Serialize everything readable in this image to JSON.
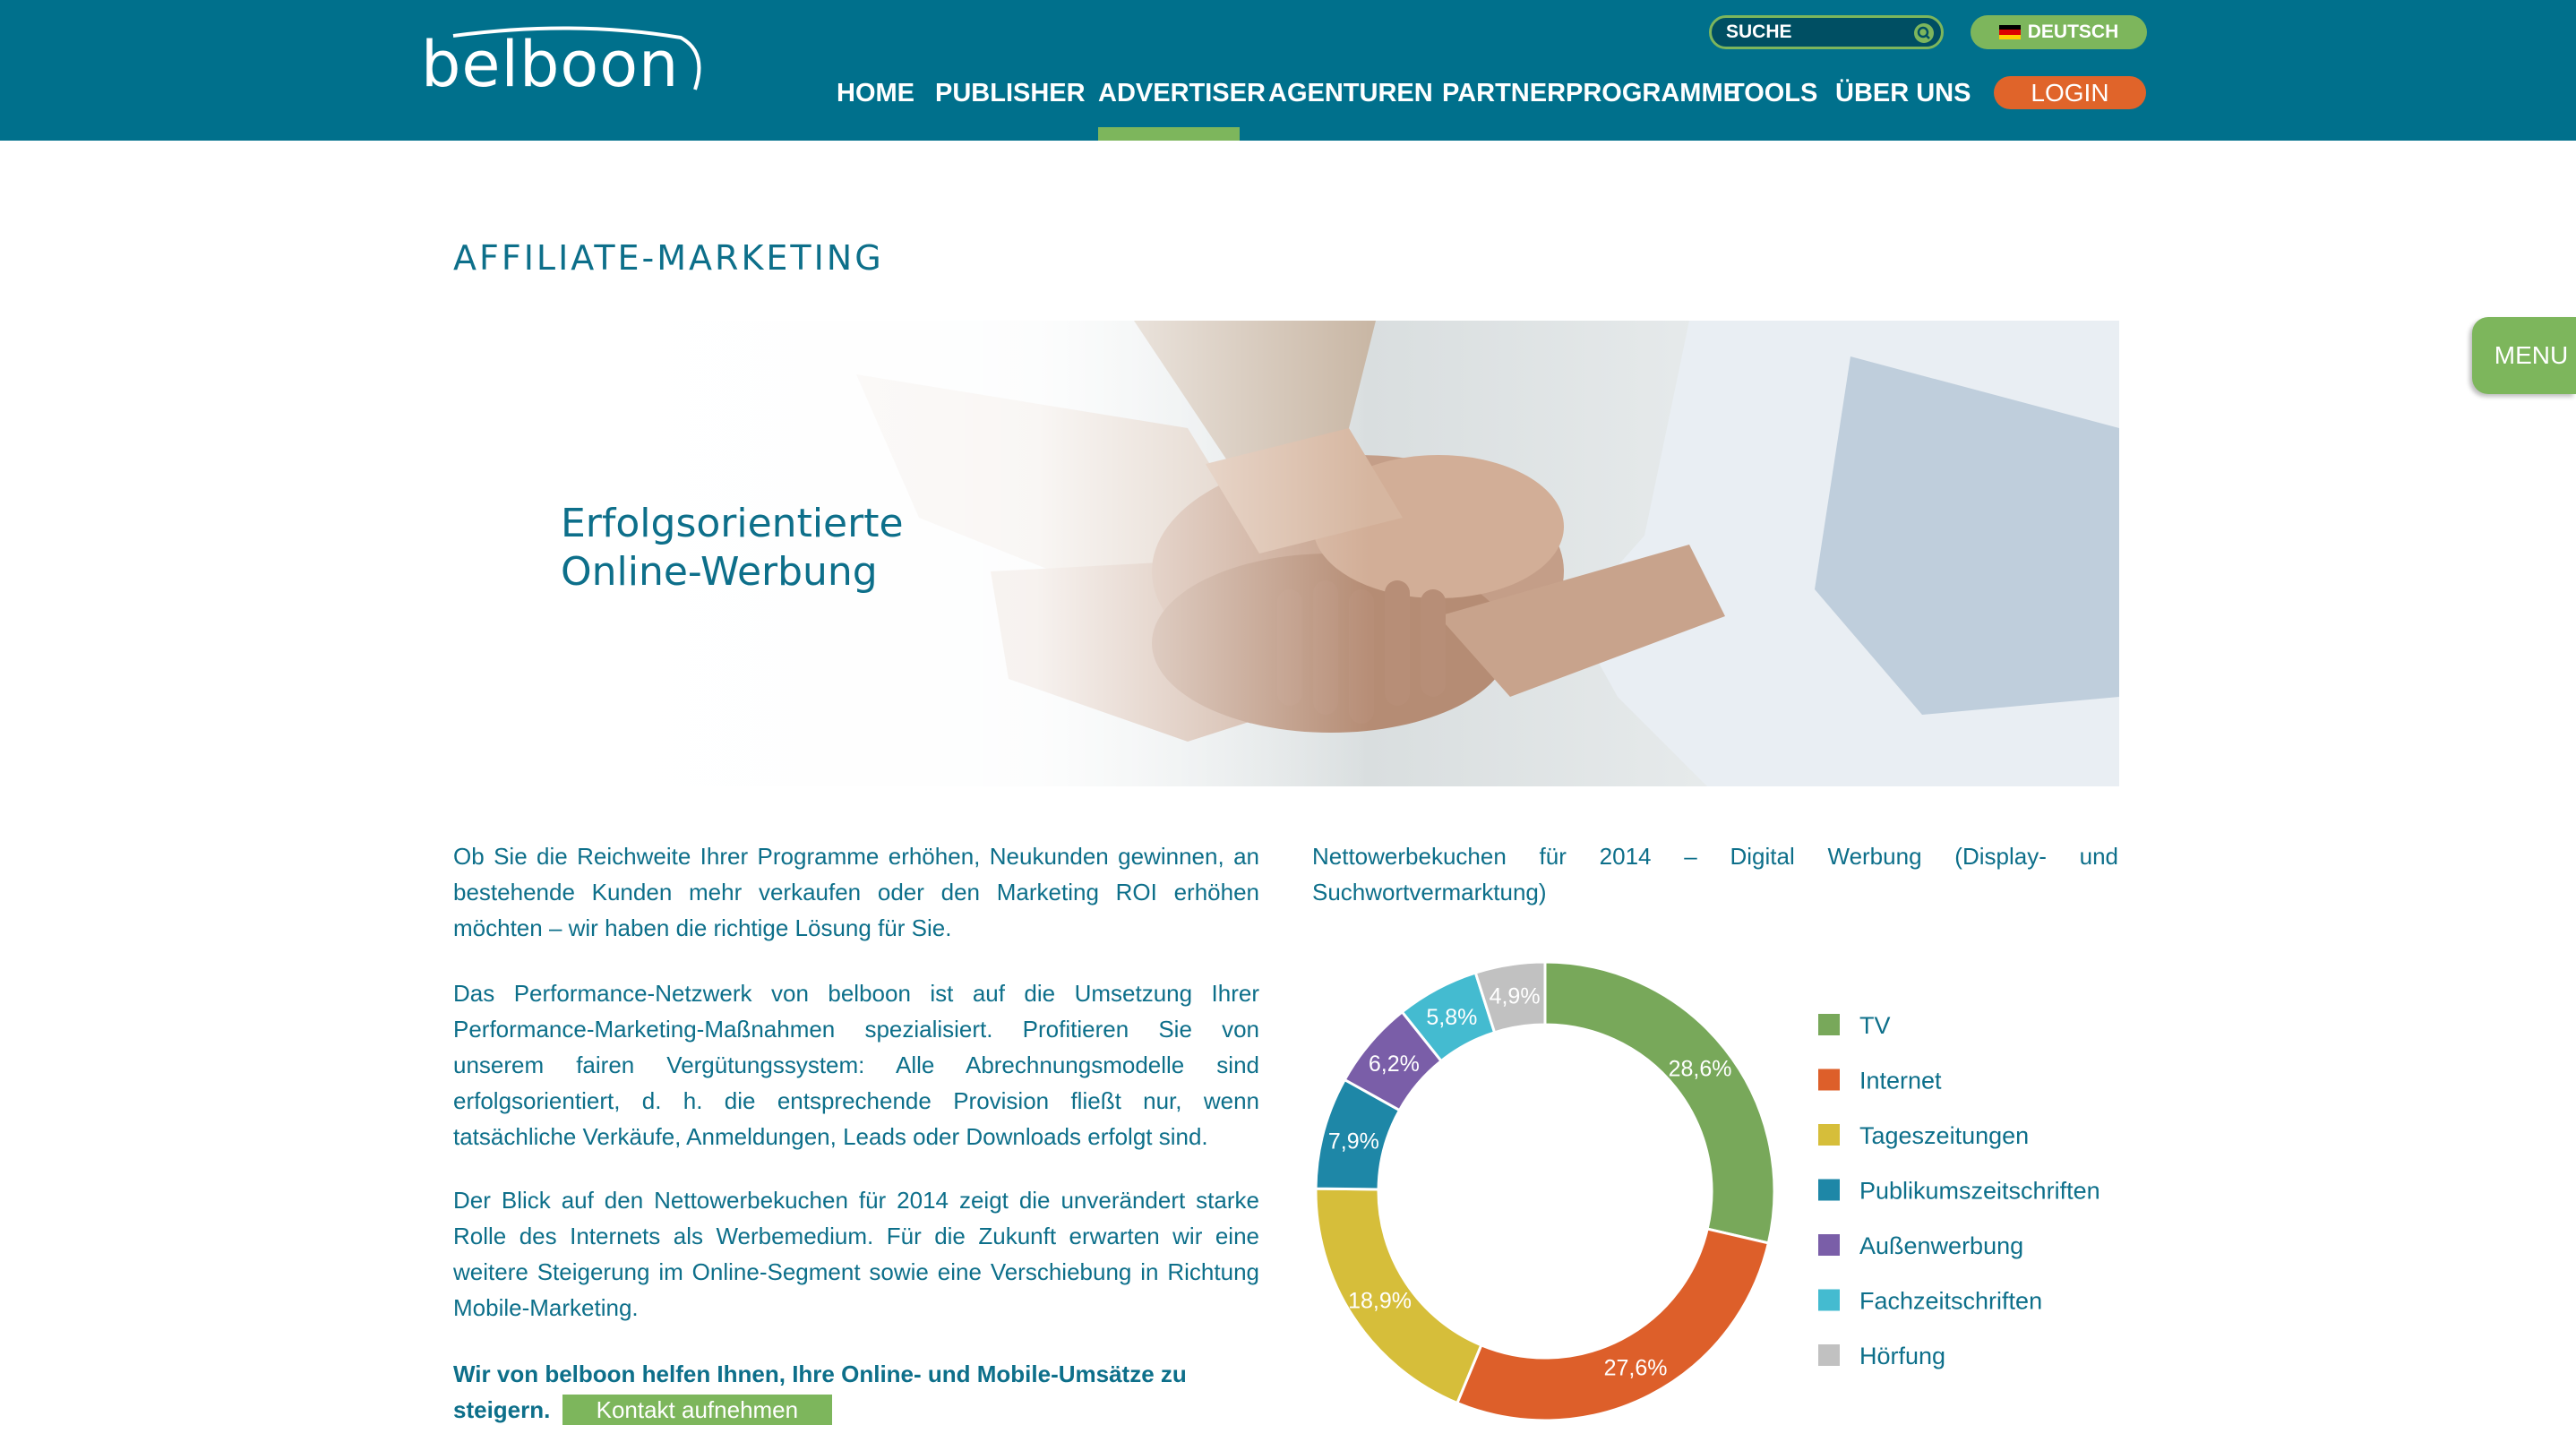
{
  "header": {
    "logo_text": "belboon",
    "search": {
      "placeholder": "SUCHE"
    },
    "language": {
      "label": "DEUTSCH",
      "flag_icon": "flag-de-icon"
    },
    "nav": [
      {
        "label": "HOME"
      },
      {
        "label": "PUBLISHER"
      },
      {
        "label": "ADVERTISER",
        "active": true
      },
      {
        "label": "AGENTUREN"
      },
      {
        "label": "PARTNERPROGRAMME"
      },
      {
        "label": "TOOLS"
      },
      {
        "label": "ÜBER UNS"
      }
    ],
    "login_label": "LOGIN"
  },
  "side_menu_label": "MENU",
  "page_title": "AFFILIATE-MARKETING",
  "hero": {
    "heading_line1": "Erfolgsorientierte",
    "heading_line2": "Online-Werbung",
    "image_icon": "stacked-hands-photo"
  },
  "content": {
    "para1": "Ob Sie die Reichweite Ihrer Programme erhöhen, Neukunden gewinnen, an bestehende Kunden mehr verkaufen oder den Marketing ROI erhöhen möchten – wir haben die richtige Lösung für Sie.",
    "para2": "Das Performance-Netzwerk von belboon ist auf die Umsetzung Ihrer Performance-Marketing-Maßnahmen spezialisiert. Profitieren Sie von unserem fairen Vergütungssystem: Alle Abrechnungsmodelle sind erfolgsorientiert, d. h. die entsprechende Provision fließt nur, wenn tatsächliche Verkäufe, Anmeldungen, Leads oder Downloads erfolgt sind.",
    "para3": "Der Blick auf den Nettowerbekuchen für 2014 zeigt die unverändert starke Rolle des Internets als Werbemedium. Für die Zukunft erwarten wir eine weitere Steigerung im Online-Segment sowie eine Verschiebung in Richtung Mobile-Marketing.",
    "cta_text": "Wir von belboon helfen Ihnen, Ihre Online- und Mobile-Umsätze zu steigern.",
    "contact_label": "Kontakt aufnehmen"
  },
  "colors": {
    "header_bg": "#00708c",
    "accent_green": "#7db65c",
    "login_orange": "#e0642a",
    "text_teal": "#0d6f8a"
  },
  "chart_data": {
    "type": "pie",
    "donut": true,
    "title": "Nettowerbekuchen für 2014 – Digital Werbung (Display- und Suchwortvermarktung)",
    "legend_position": "right",
    "series": [
      {
        "name": "TV",
        "value": 28.6,
        "label": "28,6%",
        "color": "#78a85a"
      },
      {
        "name": "Internet",
        "value": 27.6,
        "label": "27,6%",
        "color": "#dd5f2a"
      },
      {
        "name": "Tageszeitungen",
        "value": 18.9,
        "label": "18,9%",
        "color": "#d6be3a"
      },
      {
        "name": "Publikumszeitschriften",
        "value": 7.9,
        "label": "7,9%",
        "color": "#1e87a7"
      },
      {
        "name": "Außenwerbung",
        "value": 6.2,
        "label": "6,2%",
        "color": "#7a5ea8"
      },
      {
        "name": "Fachzeitschriften",
        "value": 5.8,
        "label": "5,8%",
        "color": "#44bbd0"
      },
      {
        "name": "Hörfung",
        "value": 4.9,
        "label": "4,9%",
        "color": "#c1c1c1"
      }
    ]
  }
}
